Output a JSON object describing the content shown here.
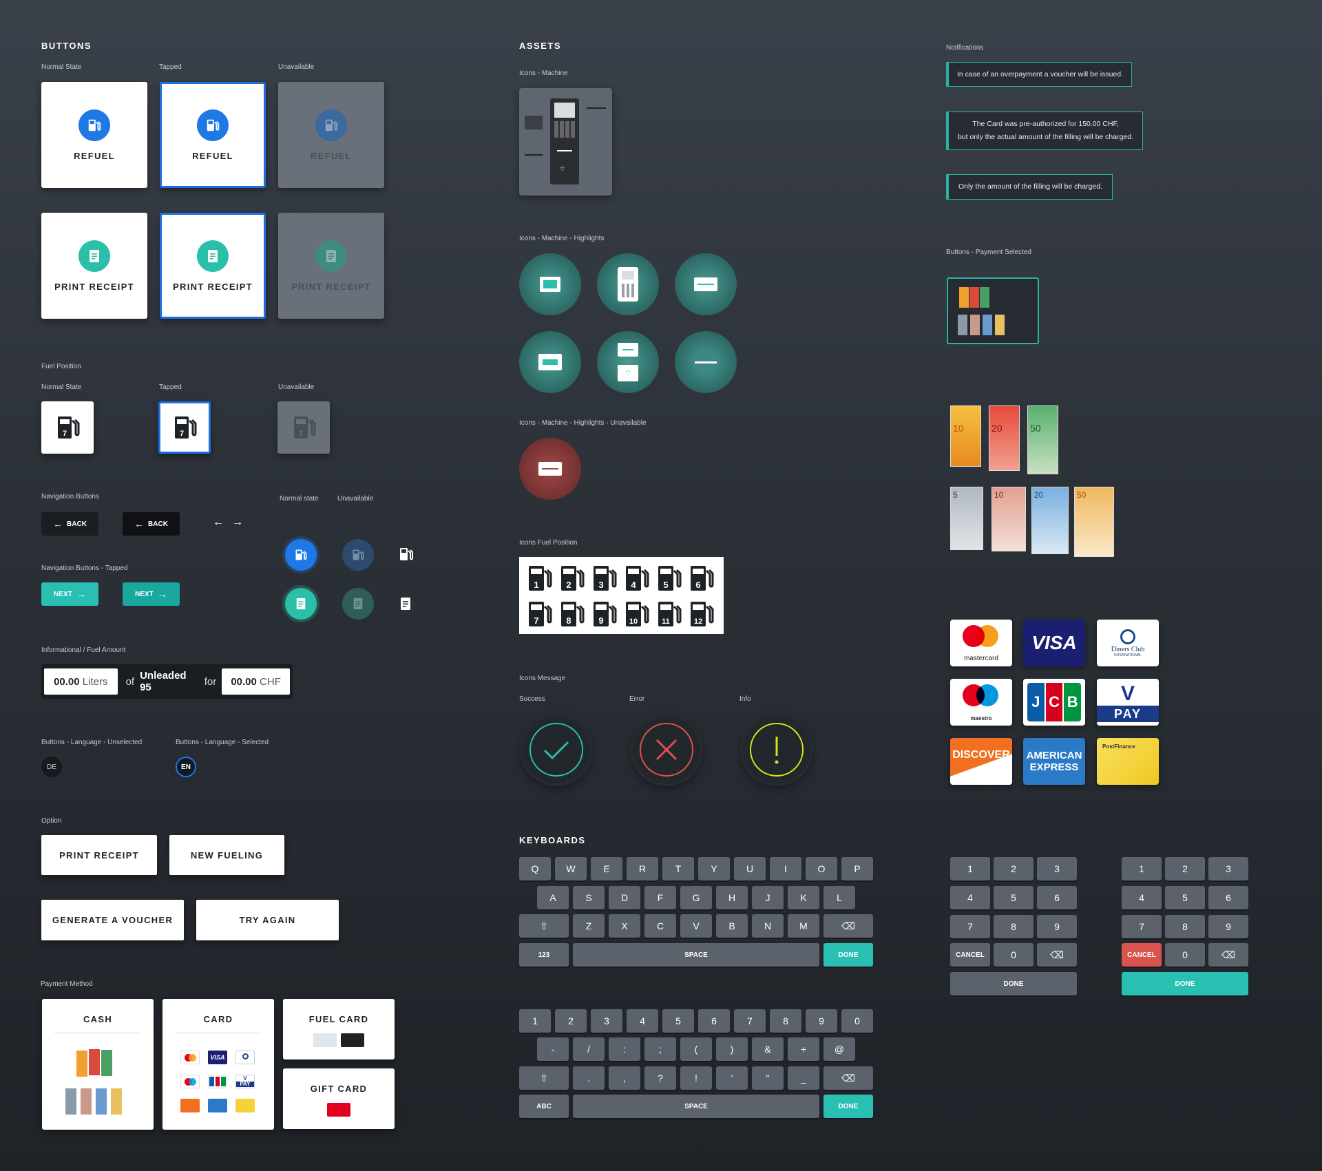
{
  "buttons": {
    "title": "BUTTONS",
    "normal": "Normal State",
    "tapped": "Tapped",
    "unavailable": "Unavailable",
    "refuel": "REFUEL",
    "print_receipt": "PRINT RECEIPT"
  },
  "fuel_position": {
    "title": "Fuel Position",
    "normal": "Normal State",
    "tapped": "Tapped",
    "unavailable": "Unavailable",
    "number": "7"
  },
  "navigation": {
    "title": "Navigation Buttons",
    "back": "BACK",
    "tapped_title": "Navigation Buttons - Tapped",
    "next": "NEXT",
    "normal_state": "Normal state",
    "unavailable": "Unavailable"
  },
  "fuel_amount": {
    "title": "Informational / Fuel Amount",
    "liters_value": "00.00",
    "liters_unit": "Liters",
    "of": "of",
    "fuel": "Unleaded 95",
    "for": "for",
    "chf_value": "00.00",
    "chf_unit": "CHF"
  },
  "language": {
    "unselected_title": "Buttons - Language - Unselected",
    "selected_title": "Buttons - Language - Selected",
    "de": "DE",
    "en": "EN"
  },
  "option": {
    "title": "Option",
    "print_receipt": "PRINT RECEIPT",
    "new_fueling": "NEW FUELING",
    "generate_voucher": "GENERATE A VOUCHER",
    "try_again": "TRY AGAIN"
  },
  "payment": {
    "title": "Payment Method",
    "cash": "CASH",
    "card": "CARD",
    "fuel_card": "FUEL CARD",
    "gift_card": "GIFT CARD"
  },
  "assets": {
    "title": "ASSETS",
    "machine": "Icons - Machine",
    "highlights": "Icons - Machine  - Highlights",
    "highlights_unavailable": "Icons - Machine  - Highlights - Unavailable",
    "fuel_position": "Icons Fuel Position",
    "fuel_numbers": [
      "1",
      "2",
      "3",
      "4",
      "5",
      "6",
      "7",
      "8",
      "9",
      "10",
      "11",
      "12"
    ],
    "message": "Icons Message",
    "success": "Success",
    "error": "Error",
    "info": "Info"
  },
  "notifications": {
    "title": "Notifications",
    "n1": "In case of an overpayment a voucher will be issued.",
    "n2a": "The Card was pre-authorized for 150.00 CHF,",
    "n2b": "but only the actual amount of the filling will be charged.",
    "n3": "Only the amount of the filling will be charged.",
    "payment_selected": "Buttons - Payment Selected"
  },
  "cards": {
    "mastercard": "mastercard",
    "visa": "VISA",
    "diners_a": "Diners Club",
    "diners_b": "INTERNATIONAL",
    "maestro": "maestro",
    "jcb": "JCB",
    "vpay_v": "V",
    "vpay": "PAY",
    "discover": "DISCOVER",
    "amex_a": "AMERICAN",
    "amex_b": "EXPRESS",
    "postfinance": "PostFinance"
  },
  "bills": {
    "chf": [
      "10",
      "20",
      "50"
    ],
    "eur": [
      "5",
      "10",
      "20",
      "50"
    ]
  },
  "keyboards": {
    "title": "KEYBOARDS",
    "row1": [
      "Q",
      "W",
      "E",
      "R",
      "T",
      "Y",
      "U",
      "I",
      "O",
      "P"
    ],
    "row2": [
      "A",
      "S",
      "D",
      "F",
      "G",
      "H",
      "J",
      "K",
      "L"
    ],
    "row3": [
      "Z",
      "X",
      "C",
      "V",
      "B",
      "N",
      "M"
    ],
    "num_label": "123",
    "space": "SPACE",
    "done": "DONE",
    "nrow1": [
      "1",
      "2",
      "3",
      "4",
      "5",
      "6",
      "7",
      "8",
      "9",
      "0"
    ],
    "srow2": [
      "-",
      "/",
      ":",
      ";",
      "(",
      ")",
      "&",
      "+",
      "@"
    ],
    "srow3": [
      ".",
      ",",
      "?",
      "!",
      "'",
      "\"",
      "_"
    ],
    "abc": "ABC",
    "pad": [
      "1",
      "2",
      "3",
      "4",
      "5",
      "6",
      "7",
      "8",
      "9"
    ],
    "zero": "0",
    "cancel": "CANCEL"
  },
  "colors": {
    "blue": "#1e78e6",
    "teal": "#2abfa8",
    "accent": "#2abfb3",
    "cancel": "#d9534f"
  }
}
